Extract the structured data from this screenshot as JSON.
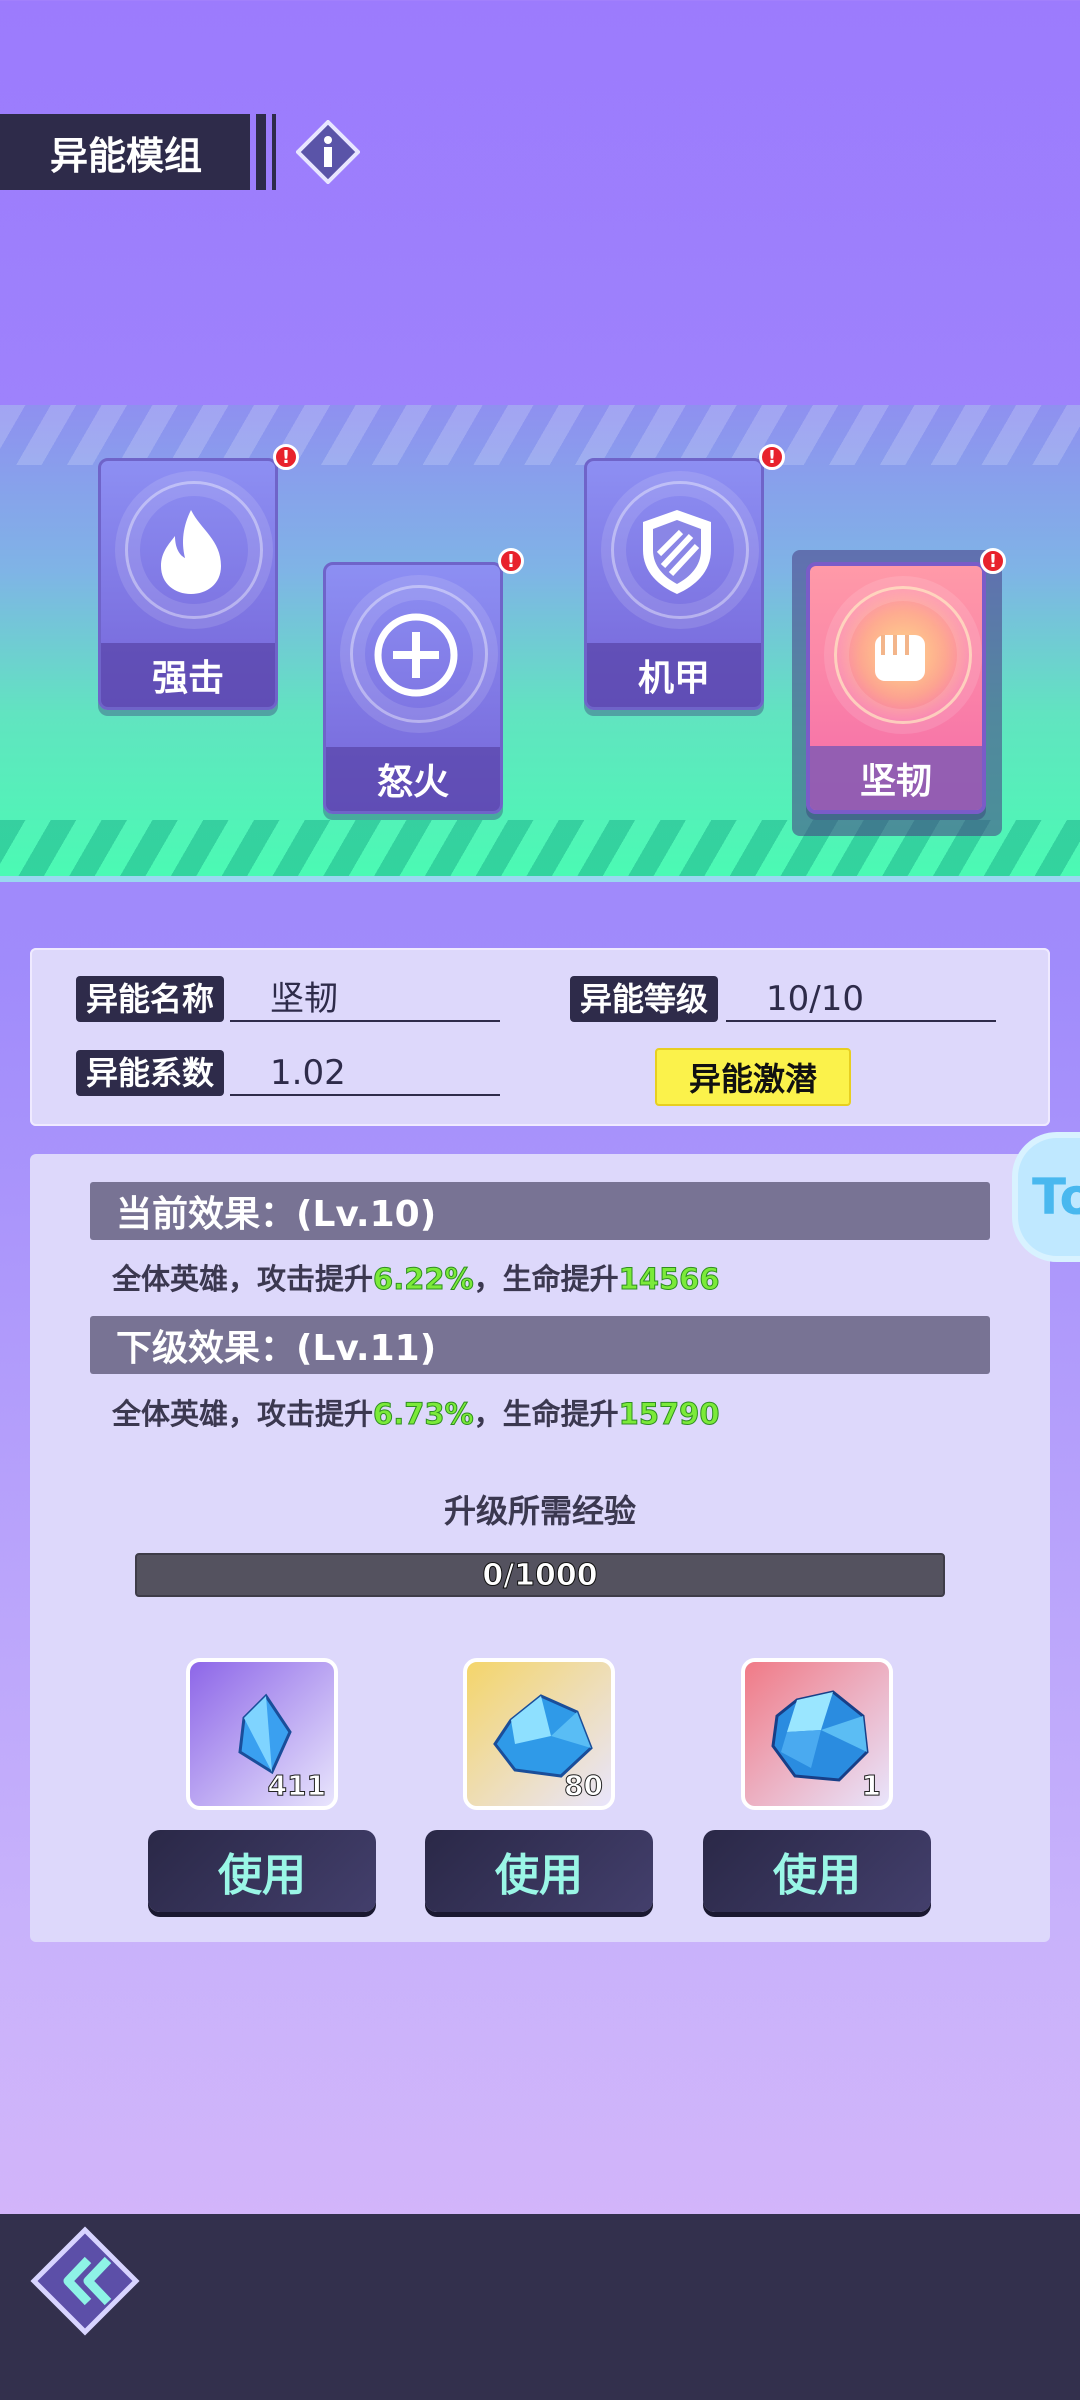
{
  "header": {
    "title": "异能模组",
    "info_icon": "info-diamond-icon"
  },
  "modules": [
    {
      "label": "强击",
      "icon": "flame-icon",
      "has_alert": true,
      "active": false
    },
    {
      "label": "怒火",
      "icon": "plus-circle-icon",
      "has_alert": true,
      "active": false
    },
    {
      "label": "机甲",
      "icon": "shield-icon",
      "has_alert": true,
      "active": false
    },
    {
      "label": "坚韧",
      "icon": "fist-icon",
      "has_alert": true,
      "active": true
    }
  ],
  "alert_mark": "!",
  "info": {
    "name_label": "异能名称",
    "name_value": "坚韧",
    "level_label": "异能等级",
    "level_value": "10/10",
    "coef_label": "异能系数",
    "coef_value": "1.02",
    "boost_button": "异能激潜"
  },
  "effects": {
    "current_head": "当前效果：(Lv.10)",
    "current": {
      "prefix": "全体英雄，攻击提升",
      "atk": "6.22%",
      "mid": "，生命提升",
      "hp": "14566"
    },
    "next_head": "下级效果：(Lv.11)",
    "next": {
      "prefix": "全体英雄，攻击提升",
      "atk": "6.73%",
      "mid": "，生命提升",
      "hp": "15790"
    }
  },
  "exp": {
    "title": "升级所需经验",
    "text": "0/1000",
    "progress": 0.0
  },
  "items": [
    {
      "icon": "small-blue-crystal-icon",
      "count": "411",
      "button": "使用",
      "bg": "#8d66e8"
    },
    {
      "icon": "blue-ore-icon",
      "count": "80",
      "button": "使用",
      "bg": "#f4d56a"
    },
    {
      "icon": "large-blue-crystal-icon",
      "count": "1",
      "button": "使用",
      "bg": "#f07a86"
    }
  ],
  "side_tab": "To",
  "colors": {
    "highlight": "#7bea39",
    "accent_yellow": "#fbf24b",
    "dark": "#2e2b4a"
  },
  "footer": {
    "back_icon": "double-chevron-left-icon"
  }
}
